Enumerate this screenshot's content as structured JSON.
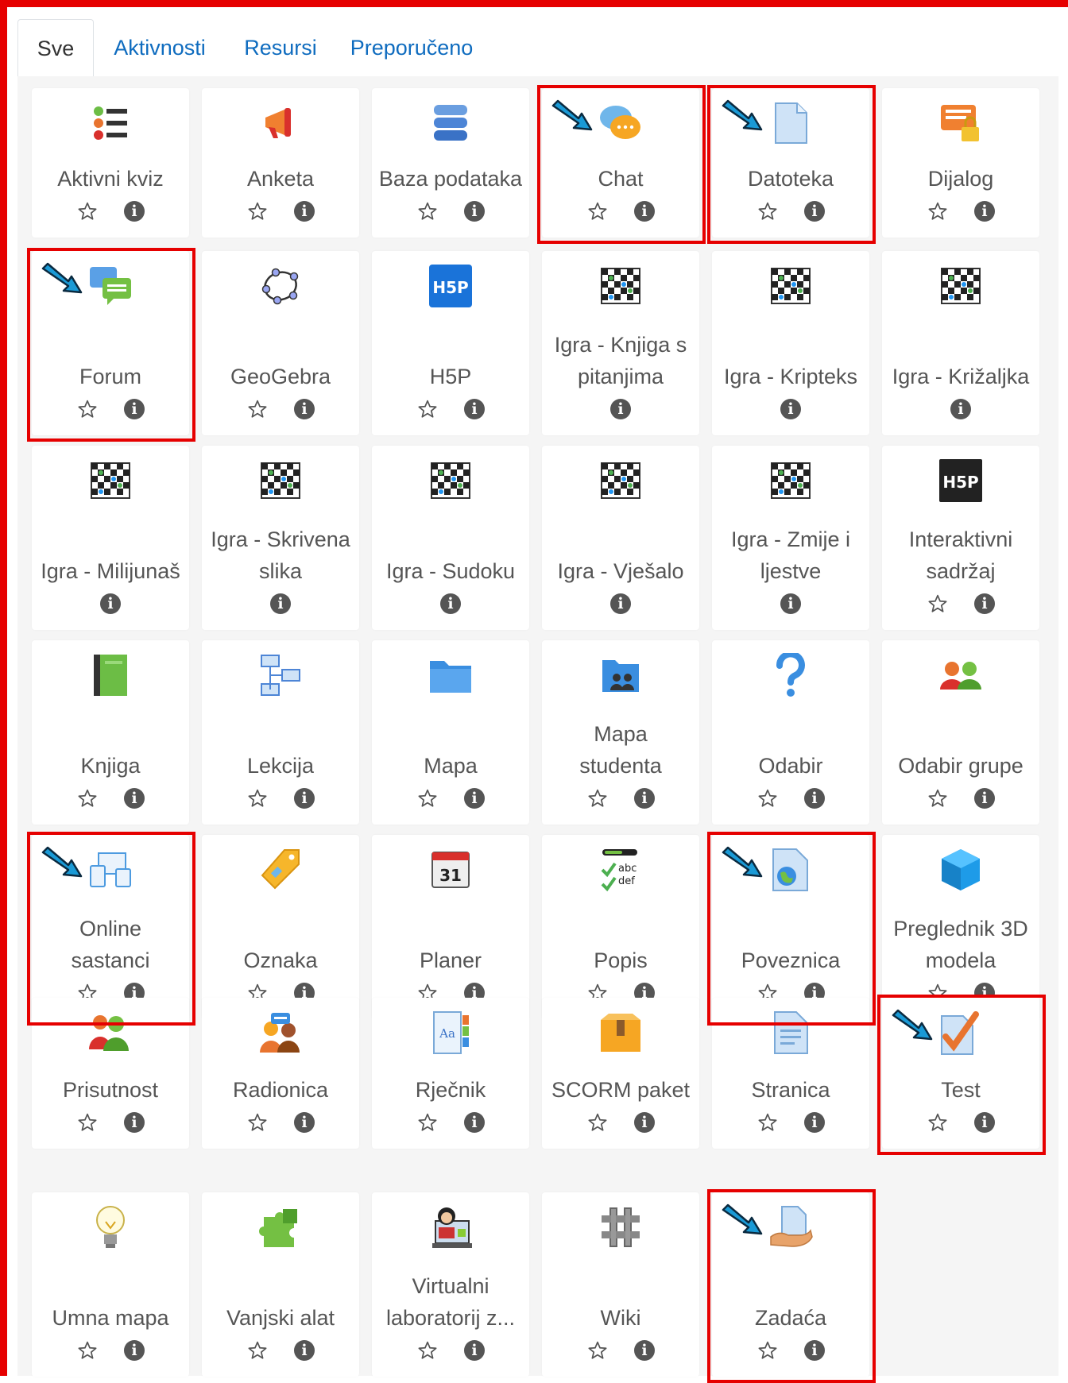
{
  "tabs": [
    {
      "label": "Sve",
      "active": true
    },
    {
      "label": "Aktivnosti",
      "active": false
    },
    {
      "label": "Resursi",
      "active": false
    },
    {
      "label": "Preporučeno",
      "active": false
    }
  ],
  "modules": [
    {
      "name": "Aktivni kviz",
      "icon": "list-icon",
      "star": true
    },
    {
      "name": "Anketa",
      "icon": "megaphone-icon",
      "star": true
    },
    {
      "name": "Baza podataka",
      "icon": "database-icon",
      "star": true
    },
    {
      "name": "Chat",
      "icon": "chat-bubble-icon",
      "star": true,
      "highlighted": true
    },
    {
      "name": "Datoteka",
      "icon": "file-icon",
      "star": true,
      "highlighted": true
    },
    {
      "name": "Dijalog",
      "icon": "dialog-lock-icon",
      "star": true
    },
    {
      "name": "Forum",
      "icon": "forum-icon",
      "star": true,
      "highlighted": true
    },
    {
      "name": "GeoGebra",
      "icon": "geogebra-icon",
      "star": true
    },
    {
      "name": "H5P",
      "icon": "h5p-icon",
      "star": true
    },
    {
      "name": "Igra - Knjiga s pitanjima",
      "lines": [
        "Igra - Knjiga s",
        "pitanjima"
      ],
      "icon": "game-board-icon",
      "star": false
    },
    {
      "name": "Igra - Kripteks",
      "icon": "game-board-icon",
      "star": false
    },
    {
      "name": "Igra - Križaljka",
      "icon": "game-board-icon",
      "star": false
    },
    {
      "name": "Igra - Milijunaš",
      "icon": "game-board-icon",
      "star": false
    },
    {
      "name": "Igra - Skrivena slika",
      "lines": [
        "Igra - Skrivena",
        "slika"
      ],
      "icon": "game-board-icon",
      "star": false
    },
    {
      "name": "Igra - Sudoku",
      "icon": "game-board-icon",
      "star": false
    },
    {
      "name": "Igra - Vješalo",
      "icon": "game-board-icon",
      "star": false
    },
    {
      "name": "Igra - Zmije i ljestve",
      "lines": [
        "Igra - Zmije i",
        "ljestve"
      ],
      "icon": "game-board-icon",
      "star": false
    },
    {
      "name": "Interaktivni sadržaj",
      "lines": [
        "Interaktivni",
        "sadržaj"
      ],
      "icon": "h5p-dark-icon",
      "star": true
    },
    {
      "name": "Knjiga",
      "icon": "book-icon",
      "star": true
    },
    {
      "name": "Lekcija",
      "icon": "lesson-icon",
      "star": true
    },
    {
      "name": "Mapa",
      "icon": "folder-icon",
      "star": true
    },
    {
      "name": "Mapa studenta",
      "lines": [
        "Mapa",
        "studenta"
      ],
      "icon": "student-folder-icon",
      "star": true
    },
    {
      "name": "Odabir",
      "icon": "question-icon",
      "star": true
    },
    {
      "name": "Odabir grupe",
      "icon": "group-choice-icon",
      "star": true
    },
    {
      "name": "Online sastanci",
      "lines": [
        "Online",
        "sastanci"
      ],
      "icon": "devices-icon",
      "star": true,
      "highlighted": true
    },
    {
      "name": "Oznaka",
      "icon": "label-tag-icon",
      "star": true
    },
    {
      "name": "Planer",
      "icon": "calendar-icon",
      "star": true
    },
    {
      "name": "Popis",
      "icon": "checklist-icon",
      "star": true
    },
    {
      "name": "Poveznica",
      "icon": "url-globe-icon",
      "star": true,
      "highlighted": true
    },
    {
      "name": "Preglednik 3D modela",
      "lines": [
        "Preglednik 3D",
        "modela"
      ],
      "icon": "cube-icon",
      "star": true
    },
    {
      "name": "Prisutnost",
      "icon": "attendance-icon",
      "star": true
    },
    {
      "name": "Radionica",
      "icon": "workshop-icon",
      "star": true
    },
    {
      "name": "Rječnik",
      "icon": "glossary-icon",
      "star": true
    },
    {
      "name": "SCORM paket",
      "icon": "scorm-box-icon",
      "star": true
    },
    {
      "name": "Stranica",
      "icon": "page-icon",
      "star": true
    },
    {
      "name": "Test",
      "icon": "quiz-check-icon",
      "star": true,
      "highlighted": true
    },
    {
      "name": "Umna mapa",
      "icon": "lightbulb-icon",
      "star": true
    },
    {
      "name": "Vanjski alat",
      "icon": "puzzle-icon",
      "star": true
    },
    {
      "name": "Virtualni laboratorij z...",
      "lines": [
        "Virtualni",
        "laboratorij z..."
      ],
      "icon": "virtual-lab-icon",
      "star": true
    },
    {
      "name": "Wiki",
      "icon": "wiki-icon",
      "star": true
    },
    {
      "name": "Zadaća",
      "icon": "assignment-hand-icon",
      "star": true,
      "highlighted": true
    }
  ],
  "colors": {
    "link": "#0f6cbf",
    "text": "#555555",
    "highlight": "#e60000",
    "arrow": "#1a9ad6"
  }
}
